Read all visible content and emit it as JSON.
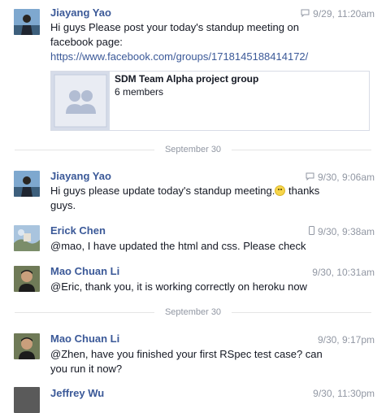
{
  "messages": [
    {
      "author": "Jiayang Yao",
      "time": "9/29, 11:20am",
      "source_icon": "chat-bubble-icon",
      "text": "Hi guys Please post your today's standup meeting on facebook page:",
      "link": "https://www.facebook.com/groups/1718145188414172/",
      "card": {
        "title": "SDM Team Alpha project group",
        "subtitle": "6 members"
      }
    },
    {
      "author": "Jiayang Yao",
      "time": "9/30, 9:06am",
      "source_icon": "chat-bubble-icon",
      "text": "Hi guys please update today's standup meeting.",
      "text_after_emoji": " thanks guys."
    },
    {
      "author": "Erick Chen",
      "time": "9/30, 9:38am",
      "source_icon": "mobile-phone-icon",
      "text": "@mao, I have updated the html and css. Please check"
    },
    {
      "author": "Mao Chuan Li",
      "time": "9/30, 10:31am",
      "text": "@Eric, thank you, it is working correctly on heroku now"
    },
    {
      "author": "Mao Chuan Li",
      "time": "9/30, 9:17pm",
      "text": "@Zhen, have you finished your first RSpec test case? can you run it now?"
    },
    {
      "author": "Jeffrey Wu",
      "time": "9/30, 11:30pm"
    }
  ],
  "dividers": [
    "September 30",
    "September 30"
  ],
  "colors": {
    "author": "#3b5998",
    "timestamp": "#9197a3",
    "divider": "#e5e5e5"
  }
}
